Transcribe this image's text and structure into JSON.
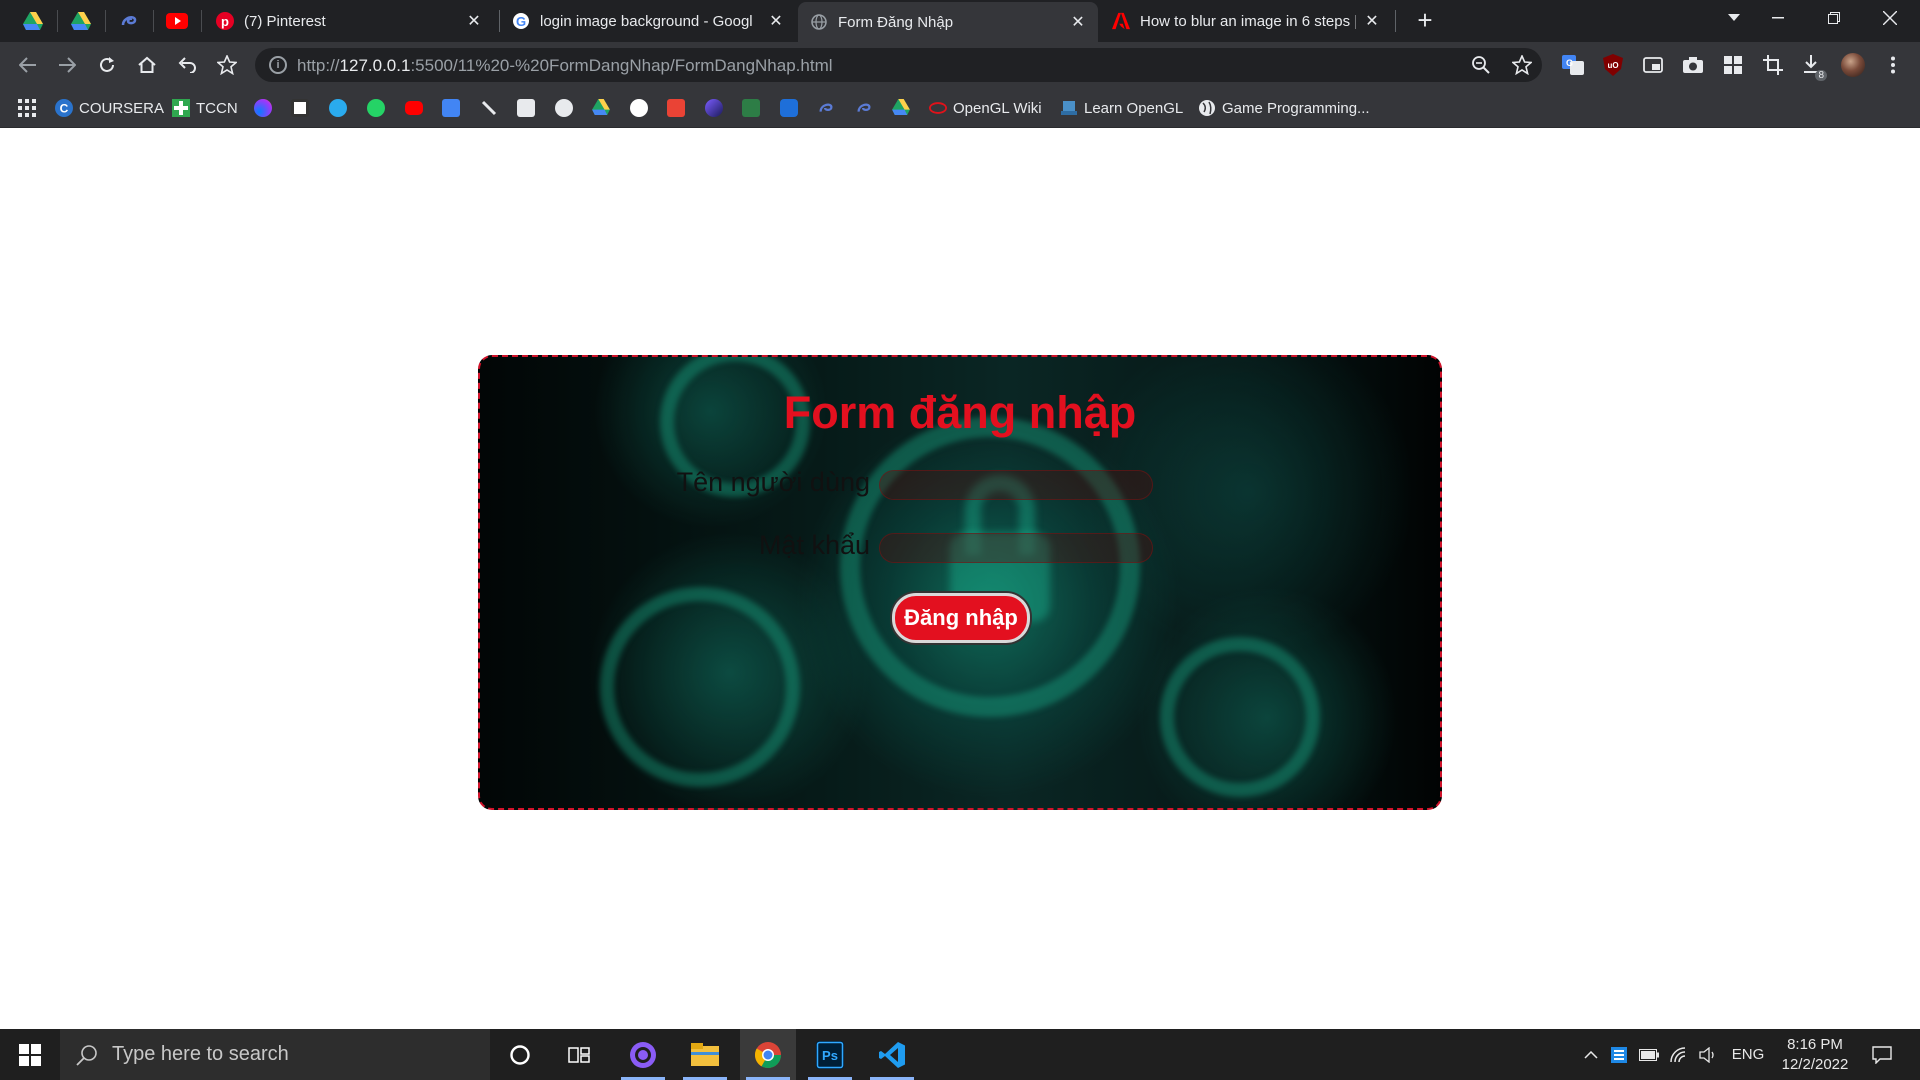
{
  "browser": {
    "pinned_tabs": [
      {
        "icon": "google-drive-icon"
      },
      {
        "icon": "google-drive-icon"
      },
      {
        "icon": "app-tab-icon"
      },
      {
        "icon": "youtube-icon"
      }
    ],
    "tabs": [
      {
        "title": "(7) Pinterest",
        "icon": "pinterest-icon",
        "active": false
      },
      {
        "title": "login image background - Googl",
        "icon": "google-icon",
        "active": false
      },
      {
        "title": "Form Đăng Nhập",
        "icon": "globe-icon",
        "active": true
      },
      {
        "title": "How to blur an image in 6 steps |",
        "icon": "adobe-icon",
        "active": false
      }
    ],
    "address": {
      "protocol": "http://",
      "host": "127.0.0.1",
      "path": ":5500/11%20-%20FormDangNhap/FormDangNhap.html"
    },
    "downloads_badge": "8",
    "bookmarks": [
      {
        "label": "COURSERA",
        "icon": "coursera-icon"
      },
      {
        "label": "TCCN",
        "icon": "tccn-icon"
      },
      {
        "label": "OpenGL Wiki",
        "icon": "opengl-icon"
      },
      {
        "label": "Learn OpenGL",
        "icon": "learnopengl-icon"
      },
      {
        "label": "Game Programming...",
        "icon": "globe-icon"
      }
    ]
  },
  "form": {
    "title": "Form đăng nhập",
    "username_label": "Tên người dùng",
    "username_value": "",
    "password_label": "Mật khẩu",
    "password_value": "",
    "submit_label": "Đăng nhập",
    "colors": {
      "accent": "#e3101f",
      "border": "#d0122a"
    }
  },
  "taskbar": {
    "search_placeholder": "Type here to search",
    "apps": [
      "cortana-icon",
      "task-view-icon",
      "github-desktop-icon",
      "file-explorer-icon",
      "chrome-icon",
      "photoshop-icon",
      "vscode-icon"
    ],
    "language": "ENG",
    "time": "8:16 PM",
    "date": "12/2/2022"
  }
}
